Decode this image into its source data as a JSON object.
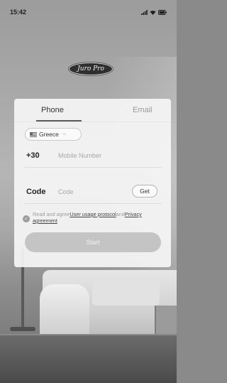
{
  "status_bar": {
    "time": "15:42"
  },
  "logo": {
    "text": "Juro Pro"
  },
  "tabs": [
    {
      "label": "Phone",
      "active": true
    },
    {
      "label": "Email",
      "active": false
    }
  ],
  "country": {
    "selected": "Greece"
  },
  "phone": {
    "dial_code": "+30",
    "placeholder": "Mobile Number"
  },
  "code": {
    "label": "Code",
    "placeholder": "Code",
    "get_label": "Get"
  },
  "agreement": {
    "prefix": "Read and agree",
    "link1": "User usage protocol",
    "middle": "and",
    "link2": "Privacy agreement"
  },
  "start": {
    "label": "Start"
  }
}
